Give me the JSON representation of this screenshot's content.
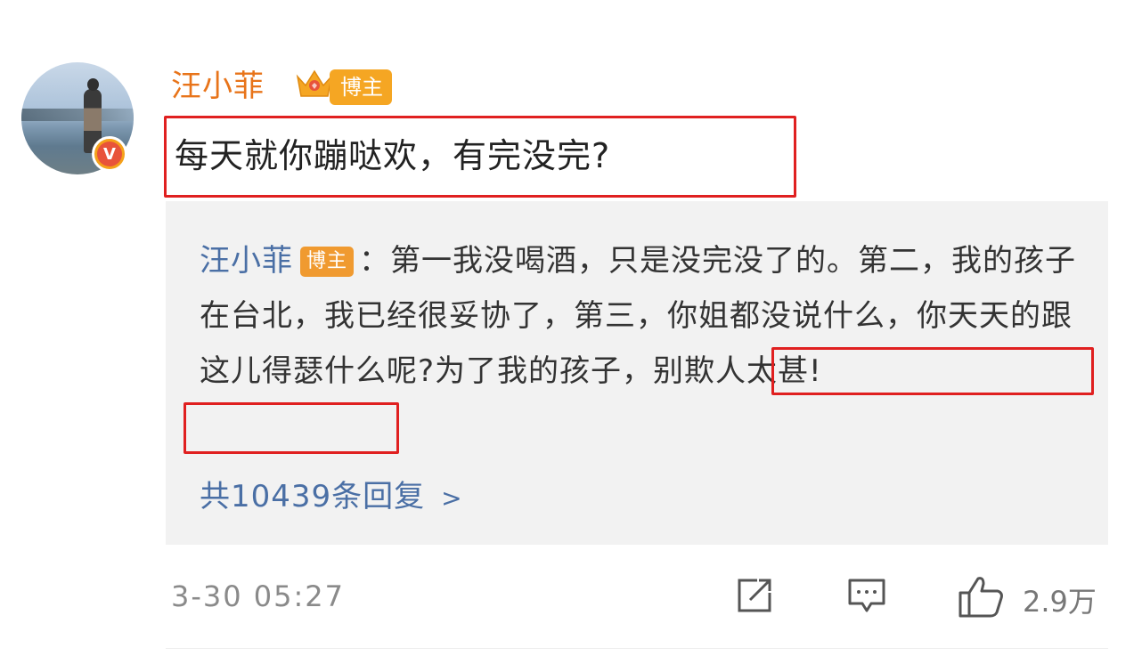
{
  "post": {
    "username": "汪小菲",
    "blogger_tag": "博主",
    "content": "每天就你蹦哒欢，有完没完?",
    "timestamp": "3-30 05:27",
    "like_count": "2.9万"
  },
  "reply": {
    "username": "汪小菲",
    "blogger_tag": "博主",
    "text_part1": "：第一我没喝酒，只是没完没了的。第二，我的孩子在台北，我已经很妥协了，第三，你姐都没说什么，你天天的跟这儿得瑟什么呢?",
    "text_highlight": "为了我的孩子，别欺人太甚!",
    "reply_count_label": "共10439条回复"
  },
  "icons": {
    "avatar_badge": "V",
    "share": "share-icon",
    "comment": "comment-icon",
    "like": "like-icon"
  },
  "colors": {
    "username_orange": "#e8741a",
    "tag_orange": "#f5a623",
    "link_blue": "#4a6fa5",
    "highlight_red": "#e02020",
    "badge_orange": "#f4a11a"
  }
}
